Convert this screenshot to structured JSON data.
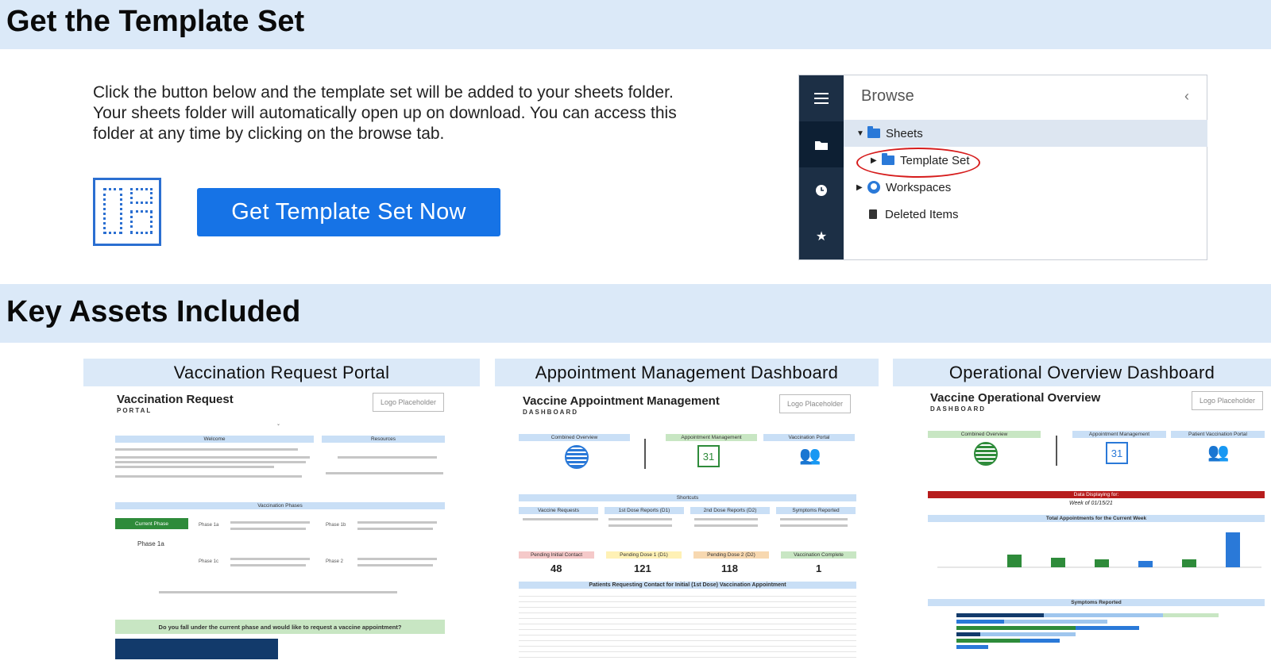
{
  "section1": {
    "title": "Get the Template Set"
  },
  "intro": {
    "text": "Click the button below and the template set will be added to your sheets folder. Your sheets folder will automatically open up on download. You can access this folder at any time by clicking on the browse tab."
  },
  "cta": {
    "label": "Get Template Set Now"
  },
  "browse": {
    "title": "Browse",
    "items": [
      {
        "label": "Sheets",
        "icon": "folder-icon"
      },
      {
        "label": "Template Set",
        "icon": "folder-icon"
      },
      {
        "label": "Workspaces",
        "icon": "workspaces-icon"
      },
      {
        "label": "Deleted Items",
        "icon": "trash-icon"
      }
    ],
    "rail_icons": [
      "menu-icon",
      "folder-icon",
      "clock-icon",
      "star-icon"
    ],
    "highlight_color": "#d61c1c"
  },
  "section2": {
    "title": "Key Assets Included"
  },
  "cards": [
    {
      "title": "Vaccination Request Portal",
      "preview": {
        "heading": "Vaccination Request",
        "subheading": "PORTAL",
        "logo": "Logo Placeholder",
        "welcome": "Welcome",
        "resources": "Resources",
        "phases_title": "Vaccination Phases",
        "current_phase_btn": "Current Phase",
        "current_phase": "Phase 1a",
        "phase_labels": [
          "Phase 1a",
          "Phase 1b",
          "Phase 1c",
          "Phase 2"
        ],
        "question": "Do you fall under the current phase and would like to request a vaccine appointment?"
      }
    },
    {
      "title": "Appointment Management Dashboard",
      "preview": {
        "heading": "Vaccine Appointment Management",
        "subheading": "DASHBOARD",
        "logo": "Logo Placeholder",
        "nav": [
          "Combined Overview",
          "Appointment Management",
          "Vaccination Portal"
        ],
        "calendar_day": "31",
        "shortcuts": "Shortcuts",
        "shortcut_cols": [
          "Vaccine Requests",
          "1st Dose Reports (D1)",
          "2nd Dose Reports (D2)",
          "Symptoms Reported"
        ],
        "stat_labels": [
          "Pending Initial Contact",
          "Pending Dose 1 (D1)",
          "Pending Dose 2 (D2)",
          "Vaccination Complete"
        ],
        "stat_values": [
          "48",
          "121",
          "118",
          "1"
        ],
        "table_title": "Patients Requesting Contact for Initial (1st Dose) Vaccination Appointment"
      }
    },
    {
      "title": "Operational Overview Dashboard",
      "preview": {
        "heading": "Vaccine Operational Overview",
        "subheading": "DASHBOARD",
        "logo": "Logo Placeholder",
        "nav": [
          "Combined Overview",
          "Appointment Management",
          "Patient Vaccination Portal"
        ],
        "calendar_day": "31",
        "data_banner": "Data Displaying for:",
        "week": "Week of 01/15/21",
        "chart_title": "Total Appointments for the Current Week",
        "symptoms_title": "Symptoms Reported"
      }
    }
  ],
  "colors": {
    "accent": "#1673e6",
    "band": "#dbe9f8",
    "rail": "#1c2f45"
  }
}
